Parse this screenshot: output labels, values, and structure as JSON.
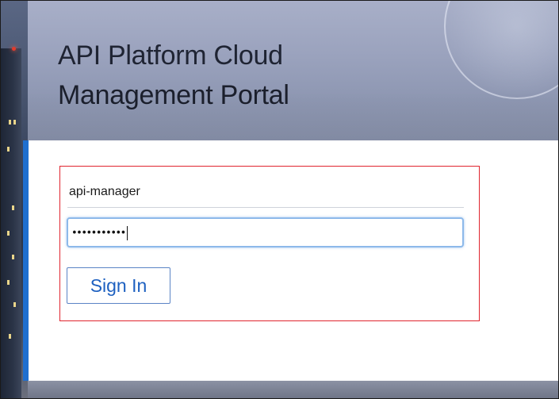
{
  "header": {
    "title_line1": "API Platform Cloud",
    "title_line2": "Management Portal"
  },
  "login": {
    "username_value": "api-manager",
    "password_masked": "•••••••••••",
    "signin_label": "Sign In"
  },
  "colors": {
    "accent": "#1f6fcf",
    "highlight": "#e0252f",
    "button_text": "#1d60c0",
    "focus_border": "#8db9ea"
  }
}
